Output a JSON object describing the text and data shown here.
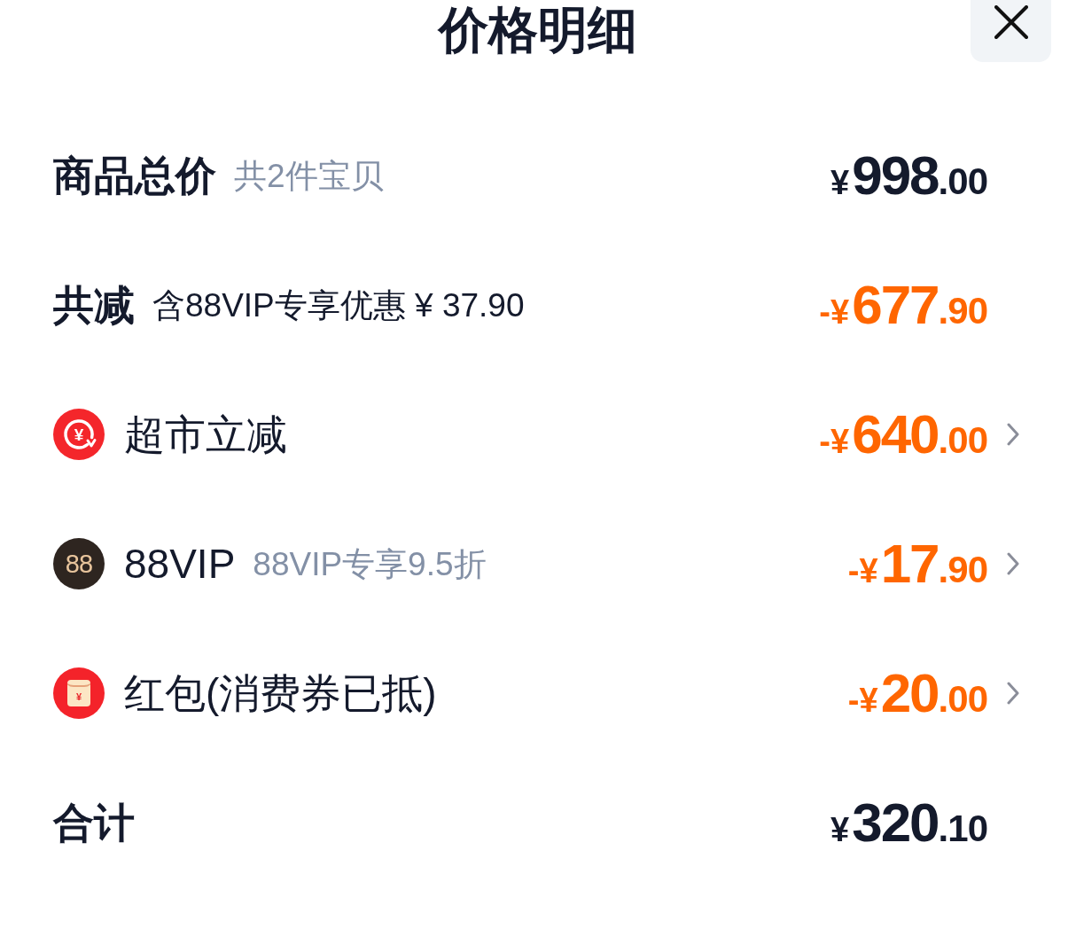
{
  "header": {
    "title": "价格明细"
  },
  "rows": [
    {
      "kind": "summary",
      "label": "商品总价",
      "note": "共2件宝贝",
      "note_muted": true,
      "discount": false,
      "price": {
        "sign": "¥",
        "integer": "998",
        "decimal": ".00"
      }
    },
    {
      "kind": "summary",
      "label": "共减",
      "note": "含88VIP专享优惠 ¥ 37.90",
      "note_muted": false,
      "discount": true,
      "price": {
        "sign": "-¥",
        "integer": "677",
        "decimal": ".90"
      }
    },
    {
      "kind": "instant",
      "badge": "¥",
      "label": "超市立减",
      "discount": true,
      "price": {
        "sign": "-¥",
        "integer": "640",
        "decimal": ".00"
      }
    },
    {
      "kind": "member",
      "badge": "88",
      "label": "88VIP",
      "note": "88VIP专享9.5折",
      "note_muted": true,
      "discount": true,
      "price": {
        "sign": "-¥",
        "integer": "17",
        "decimal": ".90"
      }
    },
    {
      "kind": "packet",
      "badge": "¥",
      "label": "红包(消费券已抵)",
      "discount": true,
      "price": {
        "sign": "-¥",
        "integer": "20",
        "decimal": ".00"
      }
    },
    {
      "kind": "summary",
      "label": "合计",
      "discount": false,
      "price": {
        "sign": "¥",
        "integer": "320",
        "decimal": ".10"
      }
    }
  ]
}
